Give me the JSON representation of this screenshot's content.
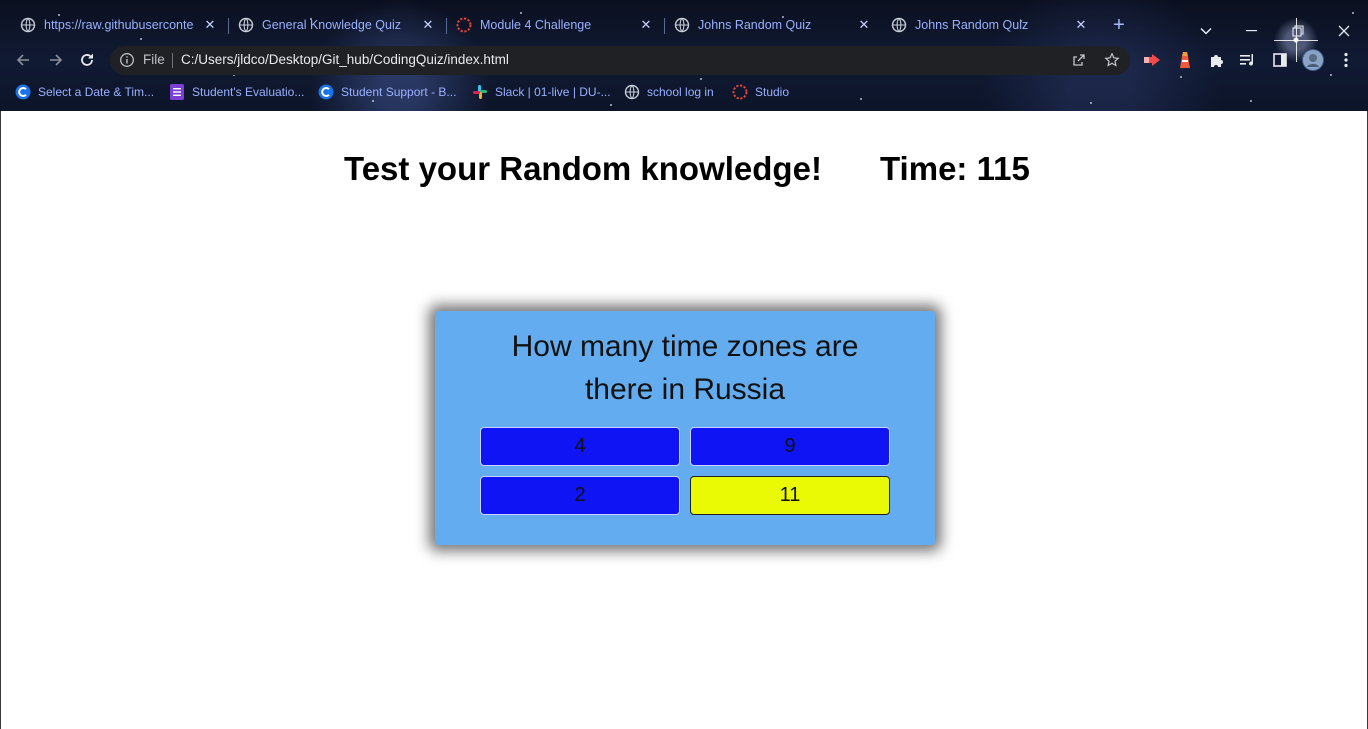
{
  "browser": {
    "tabs": [
      {
        "title": "https://raw.githubuserconte",
        "icon": "globe-icon"
      },
      {
        "title": "General Knowledge Quiz",
        "icon": "globe-icon"
      },
      {
        "title": "Module 4 Challenge",
        "icon": "dotted-circle-icon"
      },
      {
        "title": "Johns Random Quiz",
        "icon": "globe-icon"
      },
      {
        "title": "Johns Random Quiz",
        "icon": "globe-icon",
        "active": true
      }
    ],
    "omnibox": {
      "scheme_label": "File",
      "url": "C:/Users/jldco/Desktop/Git_hub/CodingQuiz/index.html"
    },
    "bookmarks": [
      {
        "label": "Select a Date & Tim...",
        "icon": "c-logo-icon"
      },
      {
        "label": "Student's Evaluatio...",
        "icon": "forms-icon"
      },
      {
        "label": "Student Support - B...",
        "icon": "c-logo-icon"
      },
      {
        "label": "Slack | 01-live | DU-...",
        "icon": "slack-icon"
      },
      {
        "label": "school log in",
        "icon": "globe-icon"
      },
      {
        "label": "Studio",
        "icon": "dotted-circle-icon"
      }
    ]
  },
  "page": {
    "heading": "Test your Random knowledge!",
    "timer": "Time: 115",
    "quiz": {
      "question": "How many time zones are there in Russia",
      "answers": [
        {
          "label": "4",
          "selected": false
        },
        {
          "label": "9",
          "selected": false
        },
        {
          "label": "2",
          "selected": false
        },
        {
          "label": "11",
          "selected": true
        }
      ]
    }
  },
  "colors": {
    "quiz_card": "#63acef",
    "answer_button": "#0e14f4",
    "answer_selected": "#eaf904"
  }
}
